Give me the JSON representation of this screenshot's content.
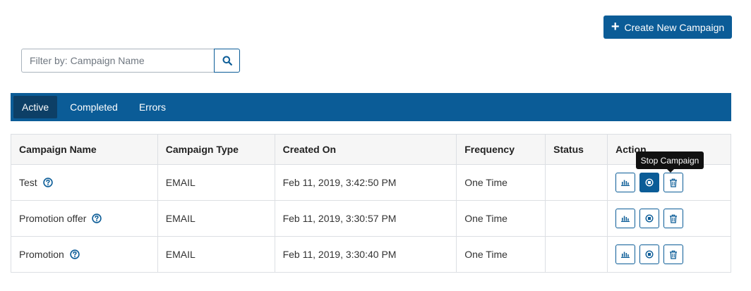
{
  "header": {
    "create_button_label": "Create New Campaign"
  },
  "filter": {
    "placeholder": "Filter by: Campaign Name",
    "value": ""
  },
  "tabs": [
    {
      "label": "Active",
      "active": true
    },
    {
      "label": "Completed",
      "active": false
    },
    {
      "label": "Errors",
      "active": false
    }
  ],
  "table": {
    "columns": [
      "Campaign Name",
      "Campaign Type",
      "Created On",
      "Frequency",
      "Status",
      "Action"
    ],
    "rows": [
      {
        "name": "Test",
        "type": "EMAIL",
        "created_on": "Feb 11, 2019, 3:42:50 PM",
        "frequency": "One Time",
        "status": ""
      },
      {
        "name": "Promotion offer",
        "type": "EMAIL",
        "created_on": "Feb 11, 2019, 3:30:57 PM",
        "frequency": "One Time",
        "status": ""
      },
      {
        "name": "Promotion",
        "type": "EMAIL",
        "created_on": "Feb 11, 2019, 3:30:40 PM",
        "frequency": "One Time",
        "status": ""
      }
    ]
  },
  "tooltip": {
    "text": "Stop Campaign"
  },
  "icons": {
    "create": "plus-icon",
    "search": "search-icon",
    "help": "help-circle-icon",
    "stats": "bar-chart-icon",
    "stop": "stop-icon",
    "delete": "trash-icon"
  },
  "colors": {
    "primary": "#0b5c97",
    "tab_active": "#0d3f66",
    "header_bg": "#f6f6f6",
    "border": "#dcdfe3"
  }
}
